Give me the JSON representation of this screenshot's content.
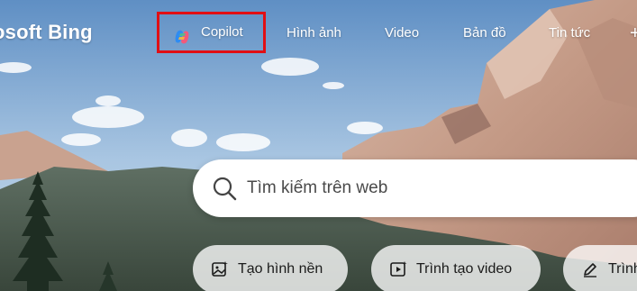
{
  "brand": {
    "logo_text": "osoft Bing"
  },
  "nav": {
    "items": [
      {
        "label": "Copilot",
        "icon": "copilot-icon",
        "highlight_color": "#e10f14"
      },
      {
        "label": "Hình ảnh"
      },
      {
        "label": "Video"
      },
      {
        "label": "Bản đồ"
      },
      {
        "label": "Tin tức"
      }
    ],
    "more_label": "+"
  },
  "search": {
    "placeholder": "Tìm kiếm trên web",
    "icon": "search-icon"
  },
  "chips": [
    {
      "label": "Tạo hình nền",
      "icon": "image-create-icon"
    },
    {
      "label": "Trình tạo video",
      "icon": "video-create-icon"
    },
    {
      "label": "Trình",
      "icon": "pen-icon"
    }
  ],
  "colors": {
    "sky": "#8fb3d6",
    "accent_red": "#e10f14"
  }
}
